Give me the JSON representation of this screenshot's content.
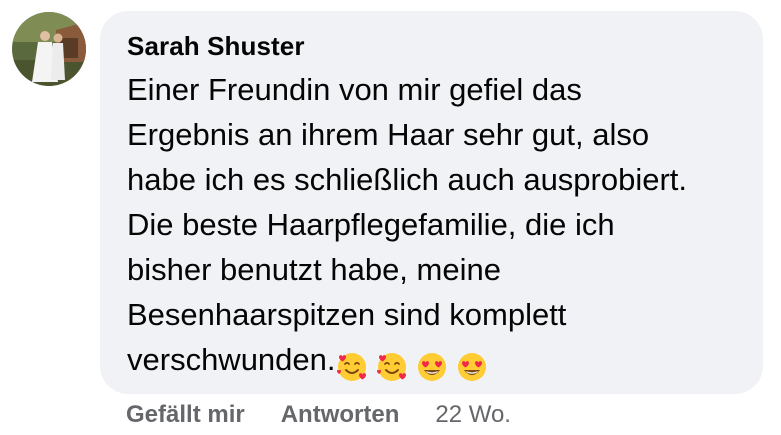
{
  "comment": {
    "author": "Sarah Shuster",
    "text": "Einer Freundin von mir gefiel das\nErgebnis an ihrem Haar sehr gut, also\nhabe ich es schließlich auch ausprobiert.\nDie beste Haarpflegefamilie, die ich\nbisher benutzt habe, meine\nBesenhaarspitzen sind komplett\nverschwunden.",
    "emojis": [
      "smiling-face-with-hearts",
      "smiling-face-with-hearts",
      "heart-eyes",
      "heart-eyes"
    ]
  },
  "actions": {
    "like_label": "Gefällt mir",
    "reply_label": "Antworten",
    "timestamp": "22 Wo."
  },
  "colors": {
    "bubble_bg": "#f0f2f5",
    "text": "#050505",
    "secondary_text": "#65676b",
    "emoji_yellow": "#ffcc33",
    "emoji_heart": "#f02849"
  }
}
